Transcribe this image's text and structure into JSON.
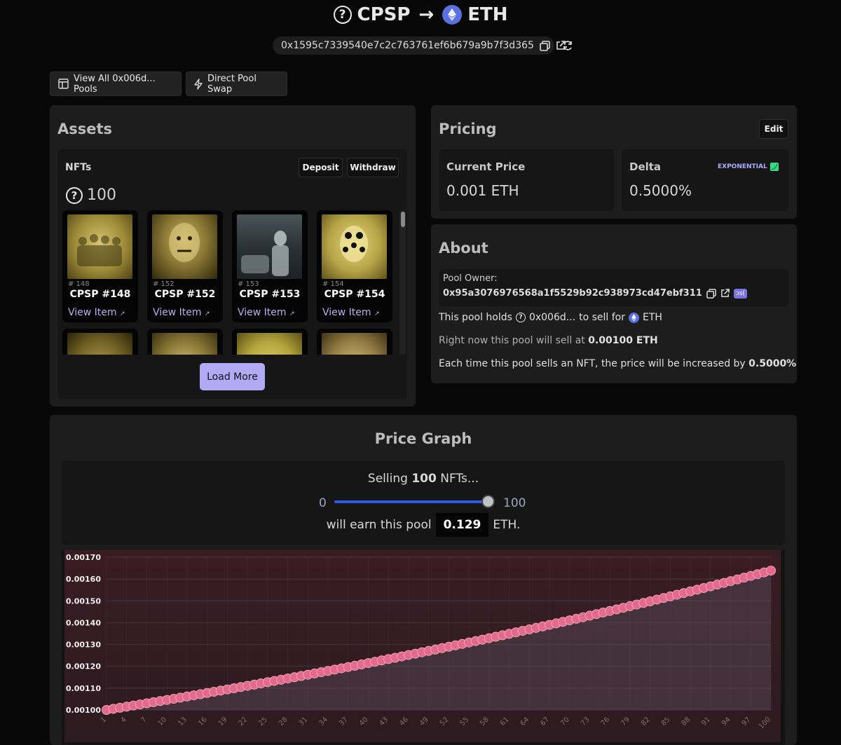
{
  "header": {
    "from_token": "CPSP",
    "arrow": "→",
    "to_token": "ETH",
    "pool_address": "0x1595c7339540e7c2c763761ef6b679a9b7f3d365"
  },
  "toolbar": {
    "view_all_label": "View All 0x006d... Pools",
    "direct_swap_label": "Direct Pool Swap"
  },
  "assets": {
    "title": "Assets",
    "nfts_label": "NFTs",
    "deposit_label": "Deposit",
    "withdraw_label": "Withdraw",
    "count": "100",
    "items": [
      {
        "num": "# 148",
        "name": "CPSP #148",
        "link": "View Item"
      },
      {
        "num": "# 152",
        "name": "CPSP #152",
        "link": "View Item"
      },
      {
        "num": "# 153",
        "name": "CPSP #153",
        "link": "View Item"
      },
      {
        "num": "# 154",
        "name": "CPSP #154",
        "link": "View Item"
      }
    ],
    "load_more_label": "Load More"
  },
  "pricing": {
    "title": "Pricing",
    "edit_label": "Edit",
    "current_price_label": "Current Price",
    "current_price_value": "0.001 ETH",
    "delta_label": "Delta",
    "delta_badge": "EXPONENTIAL",
    "delta_value": "0.5000%"
  },
  "about": {
    "title": "About",
    "owner_label": "Pool Owner:",
    "owner_address": "0x95a3076976568a1f5529b92c938973cd47ebf311",
    "owner_badge": "ɔs(",
    "holds_prefix": "This pool holds",
    "holds_token": "0x006d...",
    "holds_mid": "to sell for",
    "holds_currency": "ETH",
    "sell_prefix": "Right now this pool will sell at",
    "sell_price": "0.00100 ETH",
    "increase_text": "Each time this pool sells an NFT, the price will be increased by",
    "increase_value": "0.5000%"
  },
  "graph": {
    "title": "Price Graph",
    "selling_prefix": "Selling",
    "selling_count": "100",
    "selling_suffix": "NFTs...",
    "slider_min": "0",
    "slider_max": "100",
    "slider_value": 100,
    "earn_prefix": "will earn this pool",
    "earn_value": "0.129",
    "earn_suffix": "ETH."
  },
  "colors": {
    "accent": "#b3a9f5",
    "slider": "#2d5be3",
    "point": "#e96b8e",
    "eth": "#5a6fe0"
  },
  "chart_data": {
    "type": "line",
    "x_start": 1,
    "x_end": 100,
    "y_start": 0.001,
    "growth_per_step": 0.005,
    "x_tick_labels": [
      "1",
      "4",
      "7",
      "10",
      "13",
      "16",
      "19",
      "22",
      "25",
      "28",
      "31",
      "34",
      "37",
      "40",
      "43",
      "46",
      "49",
      "52",
      "55",
      "58",
      "61",
      "64",
      "67",
      "70",
      "73",
      "76",
      "79",
      "82",
      "85",
      "88",
      "91",
      "94",
      "97",
      "100"
    ],
    "y_tick_labels": [
      "0.00100",
      "0.00110",
      "0.00120",
      "0.00130",
      "0.00140",
      "0.00150",
      "0.00160",
      "0.00170"
    ],
    "ylim": [
      0.001,
      0.0017
    ],
    "grid": true
  }
}
